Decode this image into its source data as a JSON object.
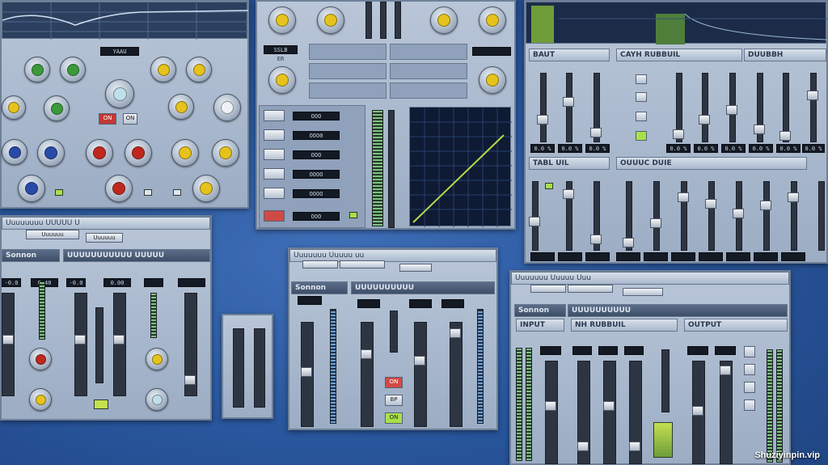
{
  "colors": {
    "background": "#2a58a0",
    "panel": "#a9b8cc",
    "knob_green": "#3a9a3a",
    "knob_yellow": "#e6c21c",
    "knob_red": "#c0281e",
    "knob_blue": "#2a4aa8",
    "curve": "#b6d84a",
    "lcd": "#141a24"
  },
  "top_left": {
    "display": "YAAU",
    "buttons": [
      "ON",
      "ON"
    ]
  },
  "top_middle": {
    "labels": [
      "SSLB",
      "ER"
    ],
    "gate_rows": [
      "OOO",
      "OOO0",
      "OOO",
      "OOOO",
      "OOOO",
      "OOO"
    ]
  },
  "top_right": {
    "section_left": "BAUT",
    "section_center": "CAYH RUBBUIL",
    "section_right": "DUUBBH",
    "lower_left": "TABL UIL",
    "lower_center": "OUUUC DUIE",
    "lcd_values": [
      "0.0 %",
      "0.0 %",
      "0.0 %",
      "0.0 %",
      "0.0 %",
      "0.0 %",
      "0.0 %",
      "0.0 %",
      "0.0 %"
    ]
  },
  "bottom_left": {
    "window_title": "Uuuuuuuu UUUUU U",
    "section_title": "Sonnon",
    "section_band": "UUUUUUUUUUU UUUUU",
    "lcd_values": [
      "-0.0",
      "0.40",
      "-0.0",
      "0.00"
    ],
    "menu": [
      "Uuuuuu",
      "Uuuuuu"
    ]
  },
  "bottom_middle": {
    "window_title": "Uuuuuuu Uuuuu uu",
    "section_title": "Sonnon",
    "section_band": "UUUUUUUUUU",
    "buttons": [
      "ON",
      "BP",
      "ON"
    ]
  },
  "bottom_right": {
    "window_title": "Uuuuuuu Uuuuu Uuu",
    "section_title": "Sonnon",
    "section_band": "UUUUUUUUUU",
    "input_label": "INPUT",
    "eq_label": "NH RUBBUIL",
    "output_label": "OUTPUT"
  },
  "watermark": "Shuziyinpin.vip"
}
